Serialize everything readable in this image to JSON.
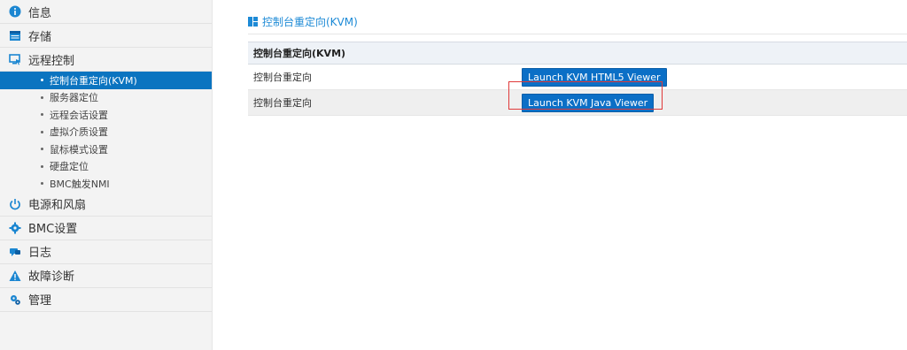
{
  "sidebar": {
    "items": [
      {
        "label": "信息",
        "icon": "info-icon"
      },
      {
        "label": "存储",
        "icon": "storage-icon"
      },
      {
        "label": "远程控制",
        "icon": "remote-control-icon"
      },
      {
        "label": "电源和风扇",
        "icon": "power-icon"
      },
      {
        "label": "BMC设置",
        "icon": "gear-icon"
      },
      {
        "label": "日志",
        "icon": "log-icon"
      },
      {
        "label": "故障诊断",
        "icon": "warning-icon"
      },
      {
        "label": "管理",
        "icon": "admin-gear-icon"
      }
    ],
    "remote_sub": [
      {
        "label": "控制台重定向(KVM)",
        "active": true
      },
      {
        "label": "服务器定位"
      },
      {
        "label": "远程会话设置"
      },
      {
        "label": "虚拟介质设置"
      },
      {
        "label": "鼠标模式设置"
      },
      {
        "label": "硬盘定位"
      },
      {
        "label": "BMC触发NMI"
      }
    ]
  },
  "main": {
    "title": "控制台重定向(KVM)",
    "table": {
      "header": "控制台重定向(KVM)",
      "rows": [
        {
          "label": "控制台重定向",
          "button": "Launch KVM HTML5 Viewer"
        },
        {
          "label": "控制台重定向",
          "button": "Launch KVM Java Viewer"
        }
      ]
    }
  },
  "colors": {
    "accent": "#0b74c0",
    "title": "#1d8ad6",
    "highlight": "#e03a3a"
  }
}
